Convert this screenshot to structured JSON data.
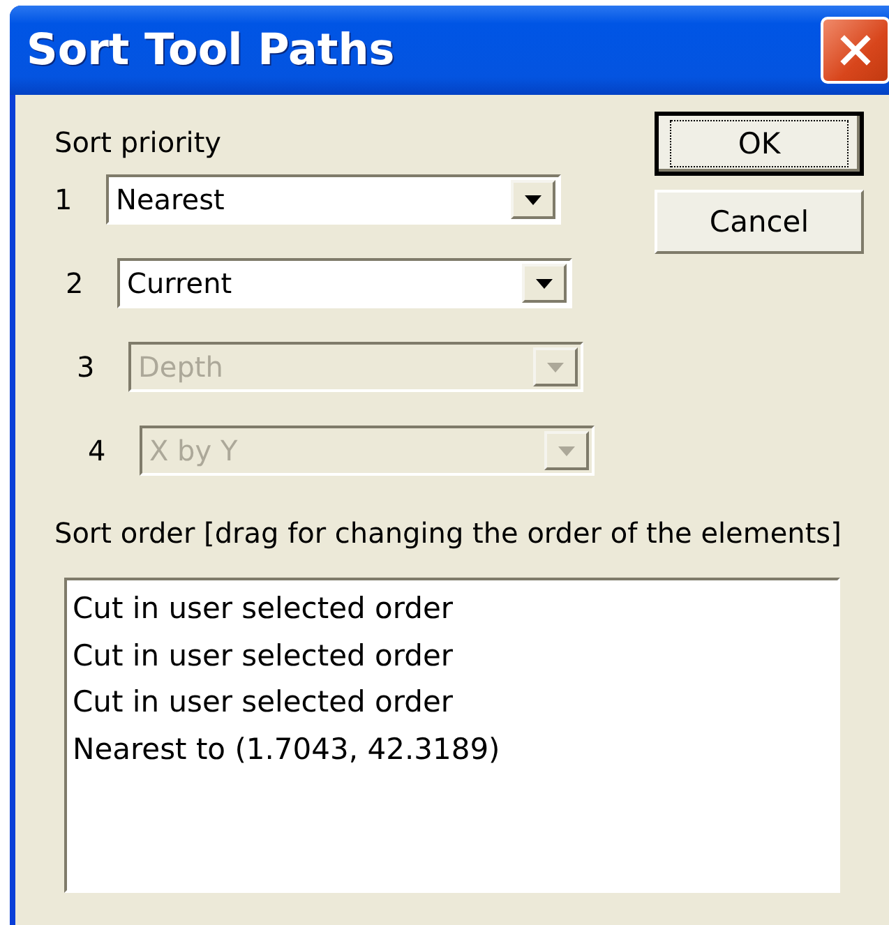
{
  "window": {
    "title": "Sort Tool Paths"
  },
  "sort_priority": {
    "label": "Sort priority",
    "rows": [
      {
        "number": "1",
        "value": "Nearest",
        "disabled": false
      },
      {
        "number": "2",
        "value": "Current",
        "disabled": false
      },
      {
        "number": "3",
        "value": "Depth",
        "disabled": true
      },
      {
        "number": "4",
        "value": "X by Y",
        "disabled": true
      }
    ]
  },
  "buttons": [
    {
      "label": "OK",
      "focused": true
    },
    {
      "label": "Cancel",
      "focused": false
    }
  ],
  "sort_order": {
    "label": "Sort order [drag for changing the order of the elements]",
    "items": [
      "Cut in user selected order",
      "Cut in user selected order",
      "Cut in user selected order",
      "Nearest to (1.7043, 42.3189)"
    ]
  }
}
